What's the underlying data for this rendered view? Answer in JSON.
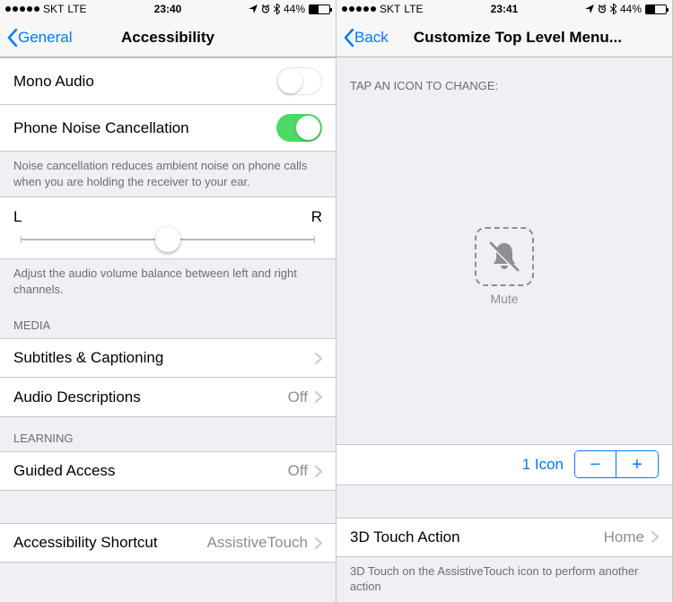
{
  "left": {
    "status": {
      "carrier": "SKT",
      "network": "LTE",
      "time": "23:40",
      "battery_pct": "44%"
    },
    "nav": {
      "back": "General",
      "title": "Accessibility"
    },
    "mono_audio": "Mono Audio",
    "noise_cancel": "Phone Noise Cancellation",
    "noise_footer": "Noise cancellation reduces ambient noise on phone calls when you are holding the receiver to your ear.",
    "balance": {
      "left": "L",
      "right": "R"
    },
    "balance_footer": "Adjust the audio volume balance between left and right channels.",
    "media_header": "MEDIA",
    "subtitles": "Subtitles & Captioning",
    "audio_desc": {
      "label": "Audio Descriptions",
      "value": "Off"
    },
    "learning_header": "LEARNING",
    "guided": {
      "label": "Guided Access",
      "value": "Off"
    },
    "shortcut": {
      "label": "Accessibility Shortcut",
      "value": "AssistiveTouch"
    }
  },
  "right": {
    "status": {
      "carrier": "SKT",
      "network": "LTE",
      "time": "23:41",
      "battery_pct": "44%"
    },
    "nav": {
      "back": "Back",
      "title": "Customize Top Level Menu..."
    },
    "tap_header": "TAP AN ICON TO CHANGE:",
    "mute_label": "Mute",
    "icon_count": "1 Icon",
    "td_action": {
      "label": "3D Touch Action",
      "value": "Home"
    },
    "td_footer": "3D Touch on the AssistiveTouch icon to perform another action"
  }
}
